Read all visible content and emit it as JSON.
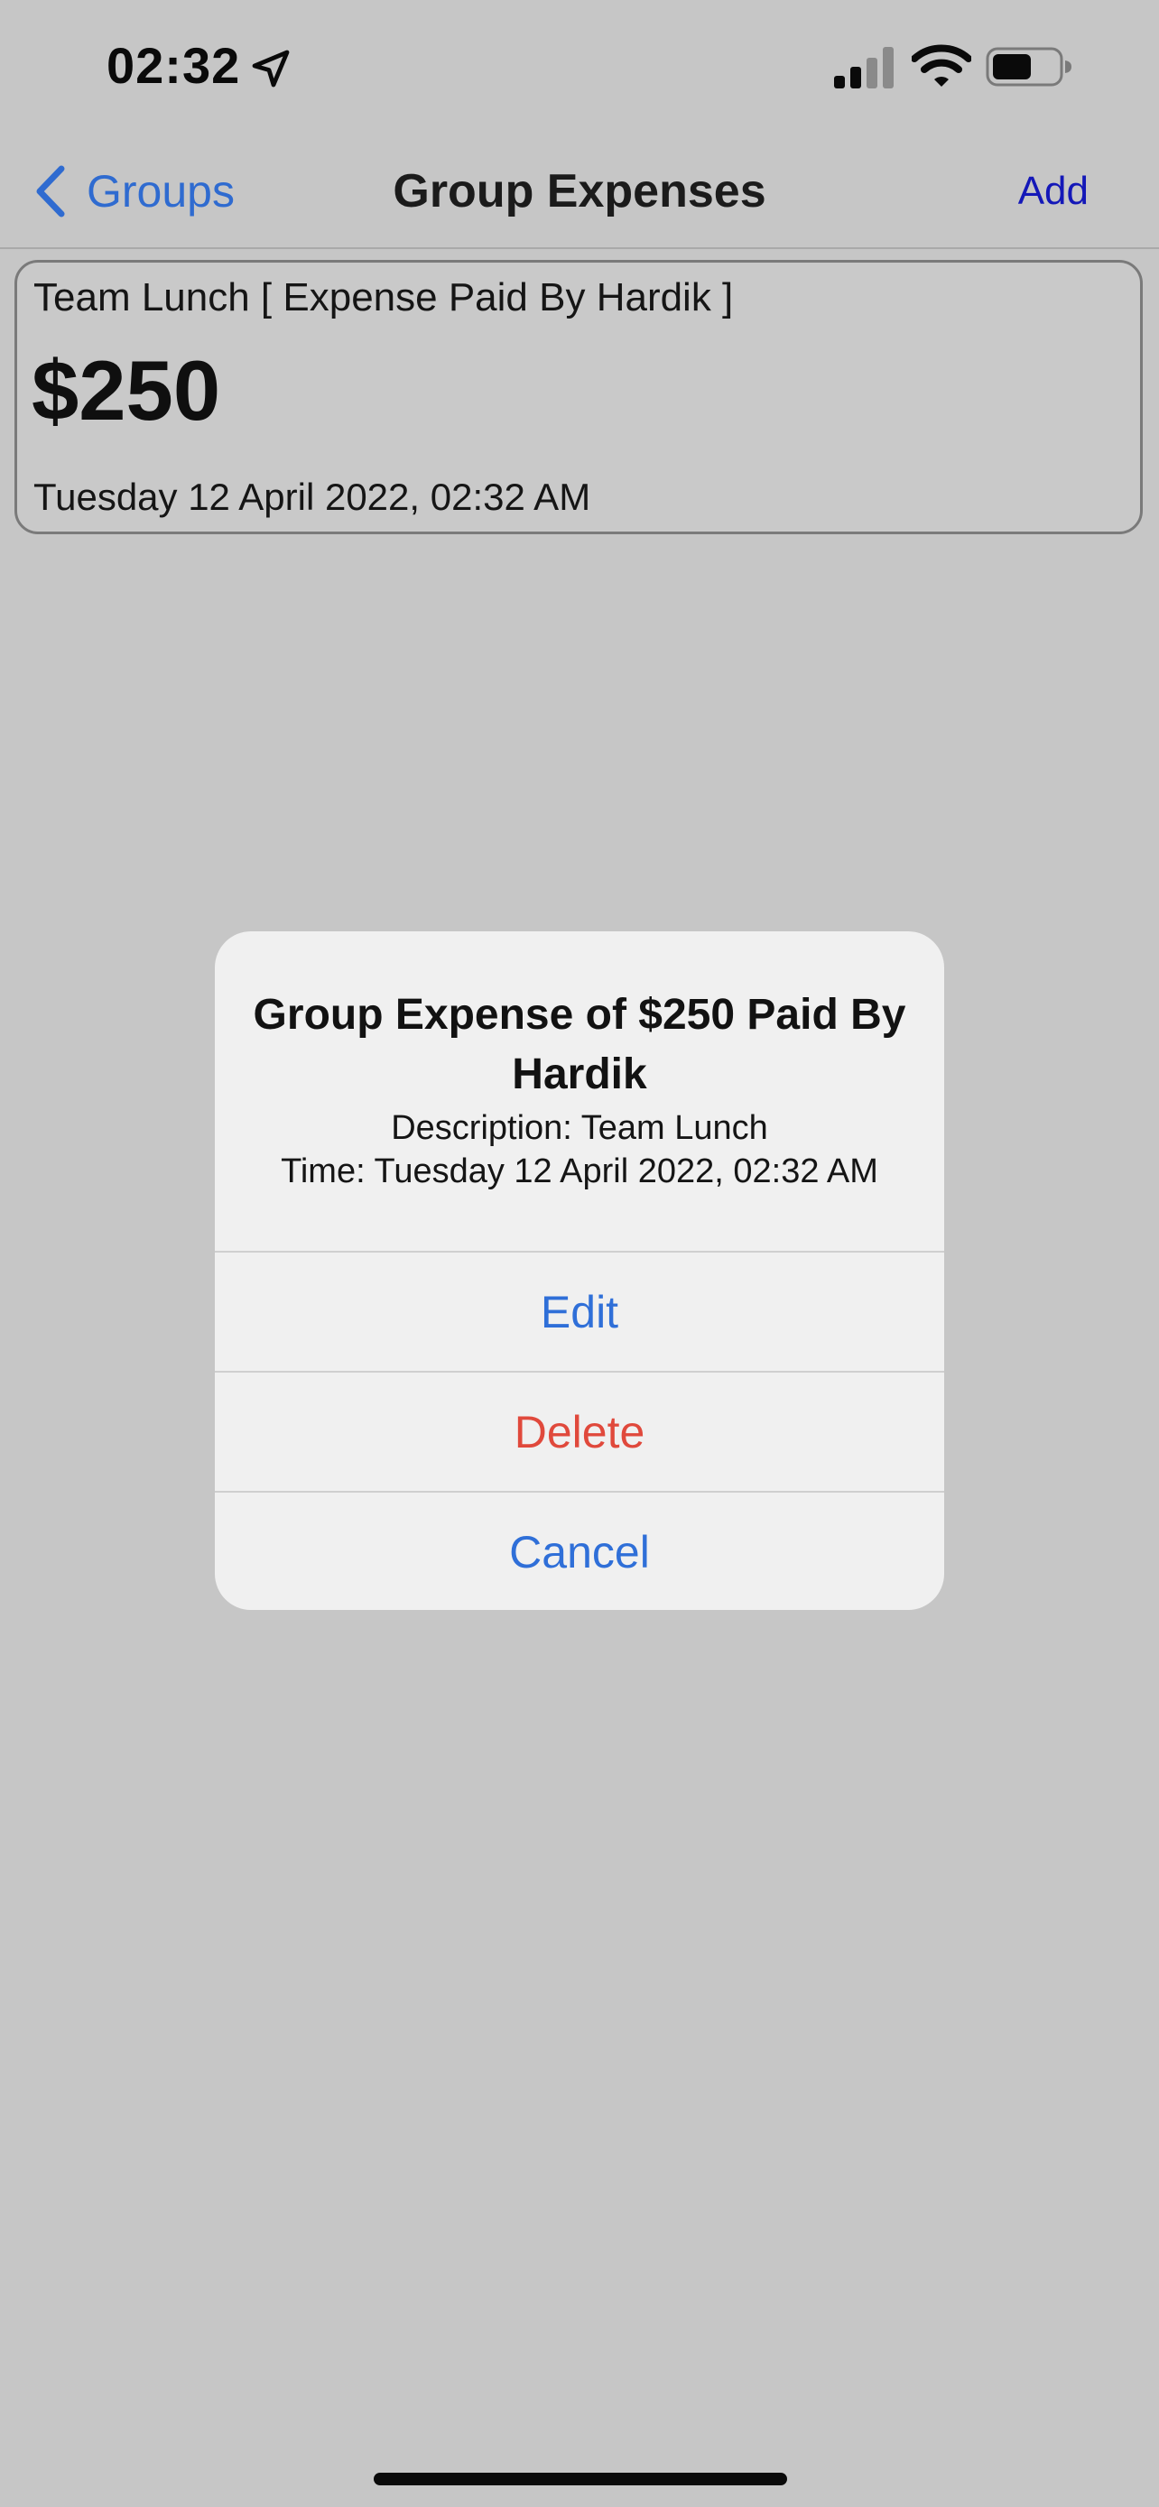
{
  "status_bar": {
    "time": "02:32",
    "location_icon": "location-arrow-icon",
    "signal_icon": "cellular-signal-icon",
    "wifi_icon": "wifi-icon",
    "battery_icon": "battery-icon"
  },
  "nav": {
    "back_label": "Groups",
    "title": "Group Expenses",
    "add_label": "Add"
  },
  "expense": {
    "title": "Team Lunch [ Expense Paid By Hardik ]",
    "amount": "$250",
    "date": "Tuesday 12 April 2022, 02:32 AM"
  },
  "alert": {
    "title": "Group Expense of $250 Paid By Hardik",
    "description": "Description: Team Lunch",
    "time": "Time: Tuesday 12 April 2022, 02:32 AM",
    "actions": {
      "edit": "Edit",
      "delete": "Delete",
      "cancel": "Cancel"
    }
  },
  "colors": {
    "background": "#c6c6c6",
    "accent_blue": "#2f6fd8",
    "destructive_red": "#e0493c",
    "add_link": "#1418b8"
  }
}
